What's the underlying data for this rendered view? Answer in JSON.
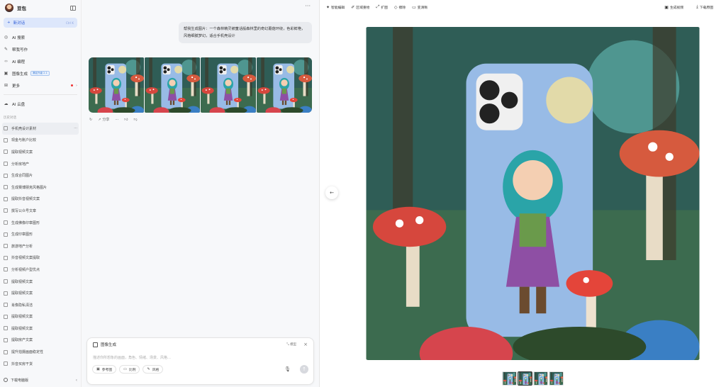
{
  "sidebar": {
    "brand": "豆包",
    "new_chat": "新对话",
    "new_chat_shortcut": "Ctrl K",
    "nav": [
      {
        "label": "AI 搜索",
        "icon": "search-icon"
      },
      {
        "label": "帮我写作",
        "icon": "pen-icon"
      },
      {
        "label": "AI 编程",
        "icon": "code-icon"
      },
      {
        "label": "图像生成",
        "icon": "image-icon",
        "badge": "满足升级 2.1"
      },
      {
        "label": "更多",
        "icon": "grid-icon"
      },
      {
        "label": "AI 云盘",
        "icon": "cloud-icon"
      }
    ],
    "history_label": "历史对话",
    "history": [
      "手机壳设计素材",
      "现金与账户比较",
      "提取视频文案",
      "分析房地产",
      "生成合同图片",
      "生成赛博朋克风格图片",
      "提取抖音视频文案",
      "撰写公众号文章",
      "生成佛像印章图形",
      "生成印章图形",
      "旅游地产分析",
      "抖音视频文案提取",
      "分析视频户型优点",
      "提取视频文案",
      "提取视频文案",
      "肖像隐私清洁",
      "提取视频文案",
      "提取视频文案",
      "提取房产文案",
      "提升拍摄画面稳定性",
      "抖音买房干货"
    ],
    "footer": "下载电脑版"
  },
  "chat": {
    "user_message": "帮我生成图片：一个森林精灵被童话般森林里的奇幻蘑菇环绕，色彩鲜艳，风格细腻梦幻，适合手机壳设计",
    "actions": {
      "share": "分享"
    },
    "composer": {
      "mode": "图像生成",
      "model": "模型",
      "placeholder": "描述你所想象的画面，角色、情绪、场景、风格…",
      "tools": [
        {
          "label": "参考图",
          "icon": "image-ref-icon"
        },
        {
          "label": "比例",
          "icon": "ratio-icon"
        },
        {
          "label": "风格",
          "icon": "style-icon"
        }
      ]
    }
  },
  "preview": {
    "toolbar_left": [
      {
        "label": "智能编辑",
        "icon": "magic-icon"
      },
      {
        "label": "区域重绘",
        "icon": "brush-icon"
      },
      {
        "label": "扩图",
        "icon": "expand-icon"
      },
      {
        "label": "擦除",
        "icon": "eraser-icon"
      },
      {
        "label": "变清晰",
        "icon": "hd-icon"
      }
    ],
    "toolbar_right": [
      {
        "label": "生成视频",
        "icon": "video-icon"
      },
      {
        "label": "下载原图",
        "icon": "download-icon"
      }
    ]
  }
}
